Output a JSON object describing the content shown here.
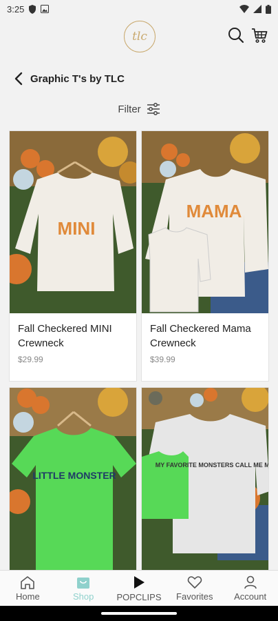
{
  "status_bar": {
    "time": "3:25",
    "icons": [
      "shield-icon",
      "image-icon",
      "wifi-icon",
      "signal-icon",
      "battery-icon"
    ]
  },
  "header": {
    "logo_text": "tlc",
    "icons": [
      "search-icon",
      "cart-icon"
    ],
    "brand_color": "#c9a96e"
  },
  "page": {
    "title": "Graphic T's by TLC",
    "filter_label": "Filter"
  },
  "products": [
    {
      "name": "Fall Checkered MINI Crewneck",
      "price": "$29.99",
      "shirt_color": "#f1ede6",
      "print": "MINI",
      "print_color": "#e08a3a"
    },
    {
      "name": "Fall Checkered Mama Crewneck",
      "price": "$39.99",
      "shirt_color": "#f1ede6",
      "print": "MAMA",
      "print_color": "#e08a3a"
    },
    {
      "name": "",
      "price": "",
      "shirt_color": "#57d957",
      "print": "LITTLE MONSTER",
      "print_color": "#1f3a66"
    },
    {
      "name": "",
      "price": "",
      "shirt_color": "#e6e6e6",
      "print": "MY FAVORITE MONSTERS CALL ME MOM",
      "print_color": "#333333"
    }
  ],
  "bottom_nav": [
    {
      "label": "Home",
      "icon": "home-icon",
      "active": false
    },
    {
      "label": "Shop",
      "icon": "shop-icon",
      "active": true
    },
    {
      "label": "POPCLIPS",
      "icon": "play-icon",
      "active": false
    },
    {
      "label": "Favorites",
      "icon": "heart-icon",
      "active": false
    },
    {
      "label": "Account",
      "icon": "account-icon",
      "active": false
    }
  ],
  "accent_color": "#8fd1cc"
}
